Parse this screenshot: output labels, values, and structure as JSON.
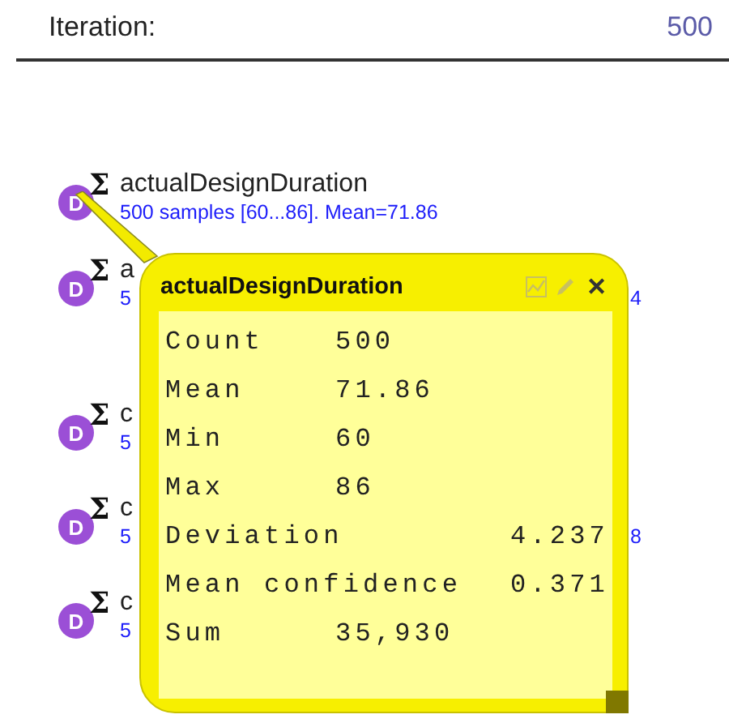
{
  "header": {
    "label": "Iteration:",
    "value": "500"
  },
  "items": [
    {
      "badge": "D",
      "sigma": "Σ",
      "name": "actualDesignDuration",
      "detail": "500 samples [60...86]. Mean=71.86"
    },
    {
      "badge": "D",
      "sigma": "Σ",
      "name": "a",
      "detail": "5",
      "detail_tail": "4"
    },
    {
      "badge": "D",
      "sigma": "Σ",
      "name": "c",
      "detail": "5"
    },
    {
      "badge": "D",
      "sigma": "Σ",
      "name": "c",
      "detail": "5",
      "detail_tail": "8"
    },
    {
      "badge": "D",
      "sigma": "Σ",
      "name": "c",
      "detail": "5"
    }
  ],
  "popup": {
    "title": "actualDesignDuration",
    "close": "✕",
    "stats": [
      {
        "kind": "short",
        "label": "Count",
        "value": "500"
      },
      {
        "kind": "short",
        "label": "Mean",
        "value": "71.86"
      },
      {
        "kind": "short",
        "label": "Min",
        "value": "60"
      },
      {
        "kind": "short",
        "label": "Max",
        "value": "86"
      },
      {
        "kind": "long",
        "label": "Deviation",
        "value": "4.237"
      },
      {
        "kind": "long",
        "label": "Mean confidence",
        "value": "0.371"
      },
      {
        "kind": "short",
        "label": "Sum",
        "value": "35,930"
      }
    ]
  }
}
